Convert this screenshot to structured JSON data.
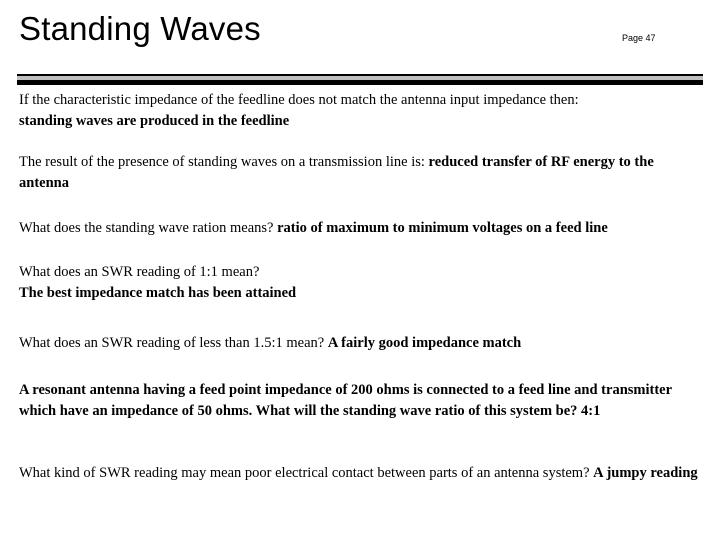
{
  "slide": {
    "title": "Standing Waves",
    "page_label": "Page 47",
    "background_color": "#ffffff",
    "text_color": "#000000",
    "divider": {
      "top_band_color": "#000000",
      "middle_band_color": "#bfbfbf",
      "bottom_band_color": "#000000"
    },
    "body": {
      "p1": {
        "question": "If the characteristic impedance of the feedline does not match the antenna  input impedance then:",
        "answer": "standing waves are produced in the  feedline"
      },
      "p2": {
        "question": "The result of the presence of standing  waves on a transmission line is:  ",
        "answer": "reduced transfer of RF energy to the  antenna"
      },
      "p3": {
        "question": "What does the standing wave ration means? ",
        "answer": "ratio of maximum to minimum voltages on a feed line"
      },
      "p4": {
        "question": "What does an SWR reading of 1:1 mean?",
        "answer": "The best impedance match has been attained"
      },
      "p5": {
        "question": "What does an SWR reading of less than 1.5:1 mean? ",
        "answer": "A fairly good impedance match"
      },
      "p6": {
        "question": "",
        "answer": "A resonant antenna having a feed point  impedance of 200 ohms is connected to  a feed line and transmitter which have an  impedance of 50 ohms. What will the  standing wave ratio of this system be?  4:1"
      },
      "p7": {
        "question": "What kind of SWR reading may mean  poor electrical contact between parts of  an antenna system?  ",
        "answer": "A jumpy reading"
      }
    }
  }
}
